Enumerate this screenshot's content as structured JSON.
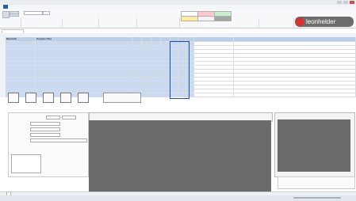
{
  "logo": {
    "text": "leonhelder"
  },
  "grid": {
    "header": [
      "Material Nr",
      "Programm Pfad",
      "",
      "",
      "",
      "",
      "",
      "",
      "",
      "",
      ""
    ],
    "rows": [
      [
        "",
        "",
        "",
        "",
        "",
        "",
        "",
        "",
        "",
        "",
        ""
      ],
      [
        "",
        "",
        "",
        "",
        "",
        "",
        "",
        "",
        "",
        "",
        ""
      ],
      [
        "",
        "",
        "",
        "",
        "",
        "",
        "",
        "",
        "",
        "",
        ""
      ],
      [
        "",
        "",
        "",
        "",
        "",
        "",
        "",
        "",
        "",
        "",
        ""
      ],
      [
        "",
        "",
        "",
        "",
        "",
        "",
        "",
        "",
        "",
        "",
        ""
      ],
      [
        "",
        "",
        "",
        "",
        "",
        "",
        "",
        "",
        "",
        "",
        ""
      ],
      [
        "",
        "",
        "",
        "",
        "",
        "",
        "",
        "",
        "",
        "",
        ""
      ],
      [
        "",
        "",
        "",
        "",
        "",
        "",
        "",
        "",
        "",
        "",
        ""
      ],
      [
        "",
        "",
        "",
        "",
        "",
        "",
        "",
        "",
        "",
        "",
        ""
      ],
      [
        "",
        "",
        "",
        "",
        "",
        "",
        "",
        "",
        "",
        "",
        ""
      ],
      [
        "",
        "",
        "",
        "",
        "",
        "",
        "",
        "",
        "",
        "",
        ""
      ],
      [
        "",
        "",
        "",
        "",
        "",
        "",
        "",
        "",
        "",
        "",
        ""
      ],
      [
        "",
        "",
        "",
        "",
        "",
        "",
        "",
        "",
        "",
        "",
        ""
      ],
      [
        "",
        "",
        "",
        "",
        "",
        "",
        "",
        "",
        "",
        "",
        ""
      ]
    ]
  },
  "shapes": [
    {
      "icon": "rectangle-icon",
      "label": ""
    },
    {
      "icon": "document-icon",
      "label": ""
    },
    {
      "icon": "page-icon",
      "label": ""
    },
    {
      "icon": "save-icon",
      "label": ""
    },
    {
      "icon": "folder-icon",
      "label": ""
    }
  ],
  "colors": {
    "ribbon": "#f7f8fa",
    "header_fill": "#b9cfe9",
    "selection_fill": "#c7daf1",
    "dark_panel": "#6b6b6b",
    "logo_red": "#d8322f"
  }
}
